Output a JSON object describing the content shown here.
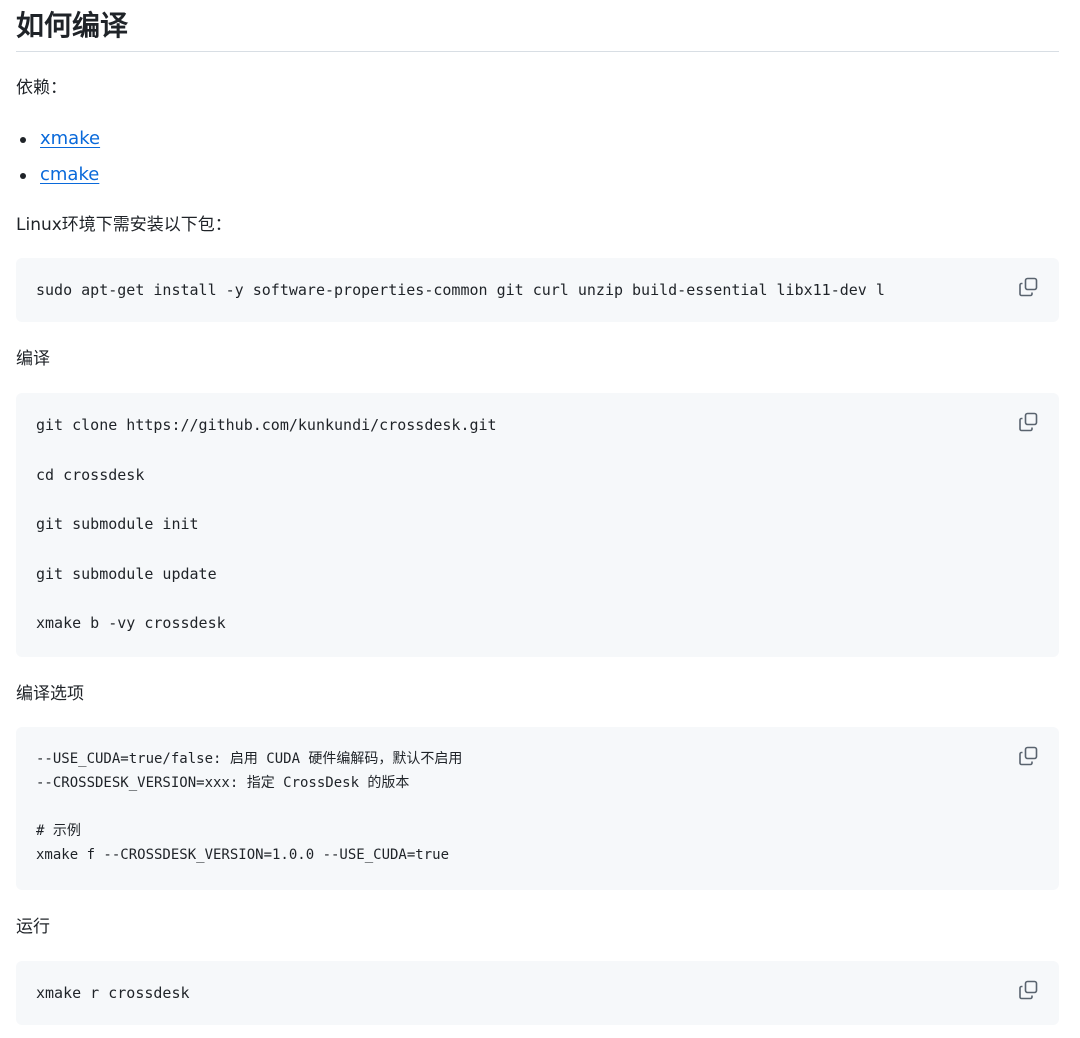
{
  "heading": "如何编译",
  "deps_label": "依赖：",
  "deps": [
    {
      "label": "xmake"
    },
    {
      "label": "cmake"
    }
  ],
  "linux_label": "Linux环境下需安装以下包：",
  "install_block": {
    "lines": [
      "sudo apt-get install -y software-properties-common git curl unzip build-essential libx11-dev l"
    ]
  },
  "build_label": "编译",
  "build_block": {
    "lines": [
      "git clone https://github.com/kunkundi/crossdesk.git",
      "cd crossdesk",
      "git submodule init",
      "git submodule update",
      "xmake b -vy crossdesk"
    ]
  },
  "options_label": "编译选项",
  "options_block": {
    "lines": [
      "--USE_CUDA=true/false: 启用 CUDA 硬件编解码，默认不启用",
      "--CROSSDESK_VERSION=xxx: 指定 CrossDesk 的版本",
      "",
      "# 示例",
      "xmake f --CROSSDESK_VERSION=1.0.0 --USE_CUDA=true"
    ]
  },
  "run_label": "运行",
  "run_block": {
    "lines": [
      "xmake r crossdesk"
    ]
  },
  "icons": {
    "copy": "copy-icon"
  },
  "colors": {
    "link": "#0969da",
    "code_bg": "#f6f8fa",
    "text": "#1f2328"
  }
}
